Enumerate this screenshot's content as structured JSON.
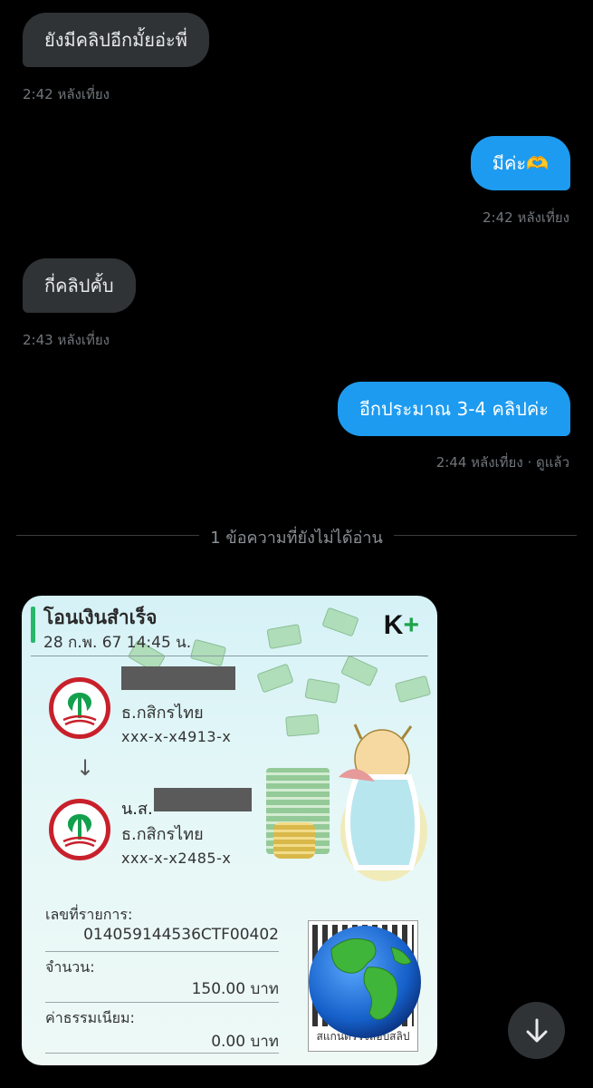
{
  "messages": [
    {
      "text": "ยังมีคลิปอีกมั้ยอ่ะพี่",
      "time": "2:42 หลังเที่ยง"
    },
    {
      "text": "มีค่ะ🫶",
      "time": "2:42 หลังเที่ยง"
    },
    {
      "text": "กี่คลิปคั้บ",
      "time": "2:43 หลังเที่ยง"
    },
    {
      "text": "อีกประมาณ 3-4 คลิปค่ะ",
      "time": "2:44 หลังเที่ยง · ดูแล้ว"
    }
  ],
  "divider_label": "1 ข้อความที่ยังไม่ได้อ่าน",
  "slip": {
    "title": "โอนเงินสำเร็จ",
    "datetime": "28 ก.พ. 67  14:45 น.",
    "logo_text": "K",
    "logo_plus": "+",
    "sender": {
      "bank": "ธ.กสิกรไทย",
      "account": "xxx-x-x4913-x"
    },
    "receiver": {
      "prefix": "น.ส.",
      "bank": "ธ.กสิกรไทย",
      "account": "xxx-x-x2485-x"
    },
    "ref_label": "เลขที่รายการ:",
    "ref_value": "014059144536CTF00402",
    "amount_label": "จำนวน:",
    "amount_value": "150.00 บาท",
    "fee_label": "ค่าธรรมเนียม:",
    "fee_value": "0.00 บาท",
    "qr_caption": "สแกนตรวจสอบสลิป"
  },
  "icons": {
    "scroll_down": "arrow-down-icon",
    "globe": "globe-icon",
    "bank": "kasikorn-logo-icon"
  },
  "colors": {
    "outgoing": "#1d9bf0",
    "incoming": "#2f3336",
    "background": "#000000",
    "bank_green": "#1fa34a"
  }
}
